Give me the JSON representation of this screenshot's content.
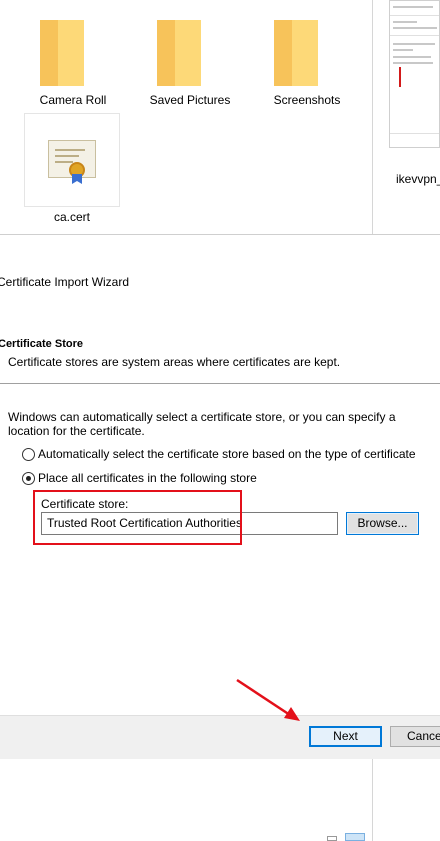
{
  "explorer": {
    "folders": [
      {
        "label": "Camera Roll"
      },
      {
        "label": "Saved Pictures"
      },
      {
        "label": "Screenshots"
      }
    ],
    "cert_file": {
      "label": "ca.cert"
    },
    "thumbnail": {
      "label": "ikevvpn_"
    }
  },
  "wizard": {
    "title": "Certificate Import Wizard",
    "header_title": "Certificate Store",
    "header_desc": "Certificate stores are system areas where certificates are kept.",
    "intro": "Windows can automatically select a certificate store, or you can specify a location for the certificate.",
    "option_auto": "Automatically select the certificate store based on the type of certificate",
    "option_place": "Place all certificates in the following store",
    "store_label": "Certificate store:",
    "store_value": "Trusted Root Certification Authorities",
    "browse_label": "Browse...",
    "next_label": "Next",
    "cancel_label": "Cance"
  },
  "colors": {
    "accent": "#0078d7",
    "annotation_red": "#e3101a",
    "folder_yellow": "#fcd36e"
  }
}
